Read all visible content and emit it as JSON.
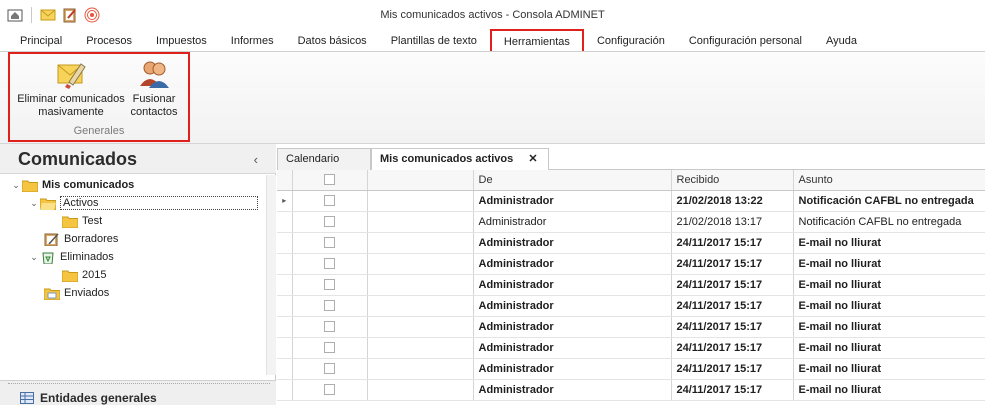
{
  "window": {
    "title": "Mis comunicados activos - Consola ADMINET"
  },
  "quick_access": [
    "home-icon",
    "mail-icon",
    "clipboard-icon",
    "broadcast-icon"
  ],
  "menu": {
    "tabs": [
      "Principal",
      "Procesos",
      "Impuestos",
      "Informes",
      "Datos básicos",
      "Plantillas de texto",
      "Herramientas",
      "Configuración",
      "Configuración personal",
      "Ayuda"
    ],
    "active": "Herramientas"
  },
  "ribbon": {
    "group_label": "Generales",
    "buttons": [
      {
        "line1": "Eliminar comunicados",
        "line2": "masivamente",
        "icon": "eraser-icon"
      },
      {
        "line1": "Fusionar",
        "line2": "contactos",
        "icon": "contacts-icon"
      }
    ]
  },
  "left_panel": {
    "title": "Comunicados",
    "tree": [
      {
        "label": "Mis comunicados",
        "level": 0,
        "expanded": true,
        "bold": true,
        "icon": "folder-icon"
      },
      {
        "label": "Activos",
        "level": 1,
        "expanded": true,
        "selected": true,
        "icon": "folder-open-icon"
      },
      {
        "label": "Test",
        "level": 2,
        "icon": "folder-icon"
      },
      {
        "label": "Borradores",
        "level": 1,
        "icon": "drafts-icon"
      },
      {
        "label": "Eliminados",
        "level": 1,
        "expanded": true,
        "icon": "recycle-icon"
      },
      {
        "label": "2015",
        "level": 2,
        "icon": "folder-icon"
      },
      {
        "label": "Enviados",
        "level": 1,
        "icon": "sent-icon"
      }
    ],
    "footer": "Entidades generales"
  },
  "doc_tabs": [
    {
      "label": "Calendario",
      "active": false
    },
    {
      "label": "Mis comunicados activos",
      "active": true,
      "close": "✕"
    }
  ],
  "grid": {
    "columns": {
      "from": "De",
      "received": "Recibido",
      "subject": "Asunto"
    },
    "rows": [
      {
        "from": "Administrador",
        "received": "21/02/2018 13:22",
        "subject": "Notificación CAFBL no entregada",
        "bold": true,
        "current": true
      },
      {
        "from": "Administrador",
        "received": "21/02/2018 13:17",
        "subject": "Notificación CAFBL no entregada",
        "bold": false
      },
      {
        "from": "Administrador",
        "received": "24/11/2017 15:17",
        "subject": "E-mail no lliurat",
        "bold": true
      },
      {
        "from": "Administrador",
        "received": "24/11/2017 15:17",
        "subject": "E-mail no lliurat",
        "bold": true
      },
      {
        "from": "Administrador",
        "received": "24/11/2017 15:17",
        "subject": "E-mail no lliurat",
        "bold": true
      },
      {
        "from": "Administrador",
        "received": "24/11/2017 15:17",
        "subject": "E-mail no lliurat",
        "bold": true
      },
      {
        "from": "Administrador",
        "received": "24/11/2017 15:17",
        "subject": "E-mail no lliurat",
        "bold": true
      },
      {
        "from": "Administrador",
        "received": "24/11/2017 15:17",
        "subject": "E-mail no lliurat",
        "bold": true
      },
      {
        "from": "Administrador",
        "received": "24/11/2017 15:17",
        "subject": "E-mail no lliurat",
        "bold": true
      },
      {
        "from": "Administrador",
        "received": "24/11/2017 15:17",
        "subject": "E-mail no lliurat",
        "bold": true
      }
    ]
  },
  "colors": {
    "highlight": "#e0201d",
    "folder": "#f5c542"
  }
}
